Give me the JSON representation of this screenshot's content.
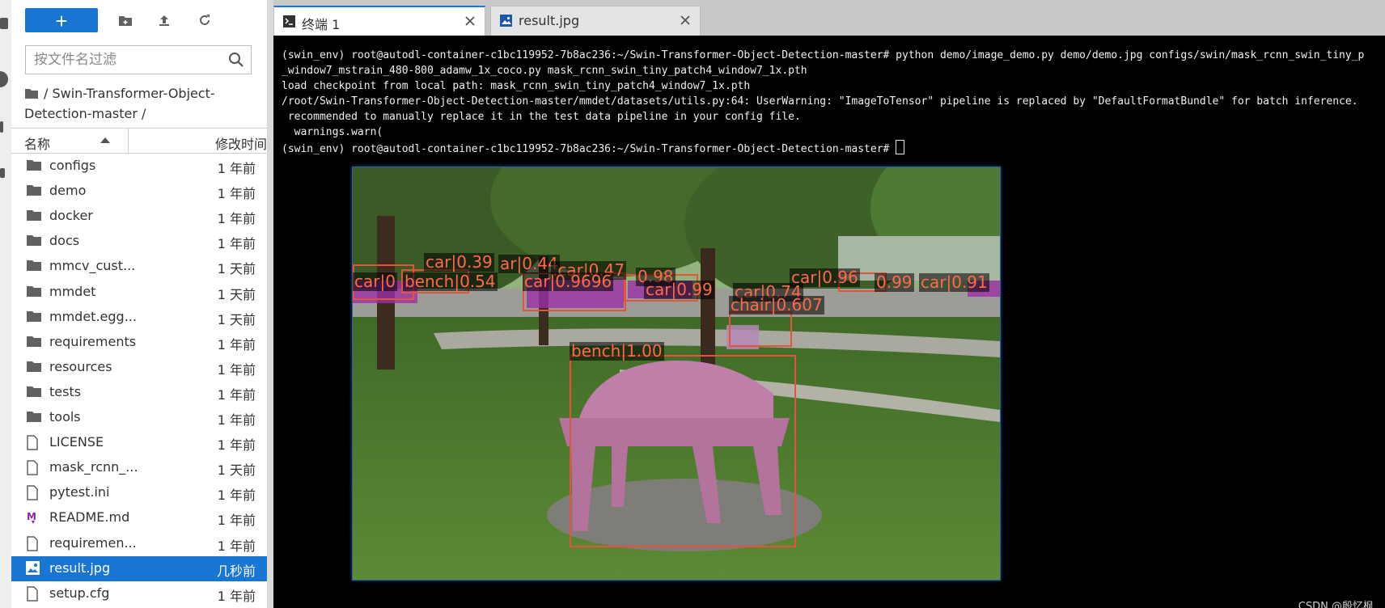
{
  "toolbar": {
    "new_label": "+"
  },
  "filter": {
    "placeholder": "按文件名过滤"
  },
  "breadcrumb": {
    "text": "/ Swin-Transformer-Object-Detection-master /"
  },
  "header": {
    "name": "名称",
    "modified": "修改时间"
  },
  "files": [
    {
      "name": "configs",
      "type": "folder",
      "modified": "1 年前"
    },
    {
      "name": "demo",
      "type": "folder",
      "modified": "1 年前"
    },
    {
      "name": "docker",
      "type": "folder",
      "modified": "1 年前"
    },
    {
      "name": "docs",
      "type": "folder",
      "modified": "1 年前"
    },
    {
      "name": "mmcv_cust...",
      "type": "folder",
      "modified": "1 天前"
    },
    {
      "name": "mmdet",
      "type": "folder",
      "modified": "1 天前"
    },
    {
      "name": "mmdet.egg...",
      "type": "folder",
      "modified": "1 天前"
    },
    {
      "name": "requirements",
      "type": "folder",
      "modified": "1 年前"
    },
    {
      "name": "resources",
      "type": "folder",
      "modified": "1 年前"
    },
    {
      "name": "tests",
      "type": "folder",
      "modified": "1 年前"
    },
    {
      "name": "tools",
      "type": "folder",
      "modified": "1 年前"
    },
    {
      "name": "LICENSE",
      "type": "file",
      "modified": "1 年前"
    },
    {
      "name": "mask_rcnn_...",
      "type": "file",
      "modified": "1 天前"
    },
    {
      "name": "pytest.ini",
      "type": "file",
      "modified": "1 年前"
    },
    {
      "name": "README.md",
      "type": "markdown",
      "modified": "1 年前"
    },
    {
      "name": "requiremen...",
      "type": "file",
      "modified": "1 年前"
    },
    {
      "name": "result.jpg",
      "type": "image",
      "modified": "几秒前",
      "selected": true
    },
    {
      "name": "setup.cfg",
      "type": "file",
      "modified": "1 年前"
    }
  ],
  "tabs": [
    {
      "label": "终端 1",
      "icon": "terminal-icon",
      "active": true
    },
    {
      "label": "result.jpg",
      "icon": "image-icon",
      "active": false
    }
  ],
  "terminal": {
    "lines": [
      "(swin_env) root@autodl-container-c1bc119952-7b8ac236:~/Swin-Transformer-Object-Detection-master# python demo/image_demo.py demo/demo.jpg configs/swin/mask_rcnn_swin_tiny_p",
      "_window7_mstrain_480-800_adamw_1x_coco.py mask_rcnn_swin_tiny_patch4_window7_1x.pth",
      "load checkpoint from local path: mask_rcnn_swin_tiny_patch4_window7_1x.pth",
      "/root/Swin-Transformer-Object-Detection-master/mmdet/datasets/utils.py:64: UserWarning: \"ImageToTensor\" pipeline is replaced by \"DefaultFormatBundle\" for batch inference.",
      " recommended to manually replace it in the test data pipeline in your config file.",
      "  warnings.warn(",
      "(swin_env) root@autodl-container-c1bc119952-7b8ac236:~/Swin-Transformer-Object-Detection-master# "
    ]
  },
  "detections": {
    "labels": [
      "car|0.39",
      "ar|0.44",
      ".car|0.47",
      "0.98",
      "car|0",
      "bench|0.54",
      "car|0.9696",
      "car|0.99",
      "car|0.96",
      "0.99",
      "car|0.91",
      "car|0.74",
      "chair|0.607",
      "bench|1.00"
    ],
    "box_color": "#e5533a",
    "mask_color": "#9c2fa6"
  },
  "watermark": "CSDN @殷忆枫",
  "colors": {
    "accent": "#1976d2",
    "terminal_bg": "#000000"
  }
}
